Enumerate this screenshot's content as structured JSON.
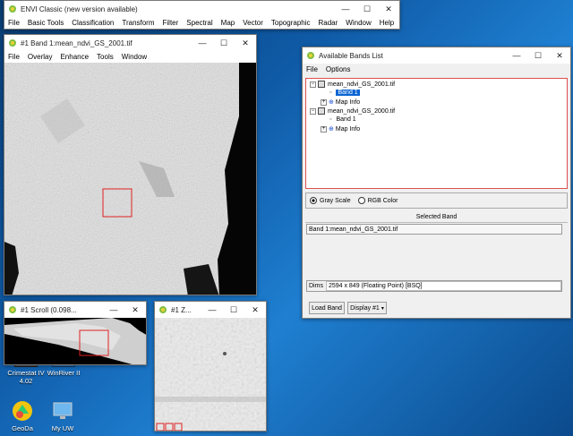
{
  "envi_main": {
    "title": "ENVI Classic (new version available)",
    "menu": [
      "File",
      "Basic Tools",
      "Classification",
      "Transform",
      "Filter",
      "Spectral",
      "Map",
      "Vector",
      "Topographic",
      "Radar",
      "Window",
      "Help"
    ]
  },
  "image_window": {
    "title": "#1 Band 1:mean_ndvi_GS_2001.tif",
    "menu": [
      "File",
      "Overlay",
      "Enhance",
      "Tools",
      "Window"
    ]
  },
  "scroll_window": {
    "title": "#1 Scroll (0.098..."
  },
  "zoom_window": {
    "title": "#1 Z..."
  },
  "bands_window": {
    "title": "Available Bands List",
    "menu": [
      "File",
      "Options"
    ],
    "tree": [
      {
        "file": "mean_ndvi_GS_2001.tif",
        "band": "Band 1",
        "map": "Map Info",
        "band_selected": true
      },
      {
        "file": "mean_ndvi_GS_2000.tif",
        "band": "Band 1",
        "map": "Map Info",
        "band_selected": false
      }
    ],
    "gray_scale_label": "Gray Scale",
    "rgb_label": "RGB Color",
    "selected_band_header": "Selected Band",
    "selected_band_value": "Band 1:mean_ndvi_GS_2001.tif",
    "dims_label": "Dims",
    "dims_value": "2594 x 849 (Floating Point) [BSQ]",
    "load_band": "Load Band",
    "display": "Display #1"
  },
  "desktop": {
    "icons": [
      {
        "line1": "Crimestat IV",
        "line2": "4.02"
      },
      {
        "line1": "WinRiver II",
        "line2": ""
      },
      {
        "line1": "GeoDa",
        "line2": ""
      },
      {
        "line1": "My UW",
        "line2": ""
      }
    ]
  },
  "colors": {
    "accent": "#0a64d2",
    "desktop": "#0f5aa6"
  }
}
